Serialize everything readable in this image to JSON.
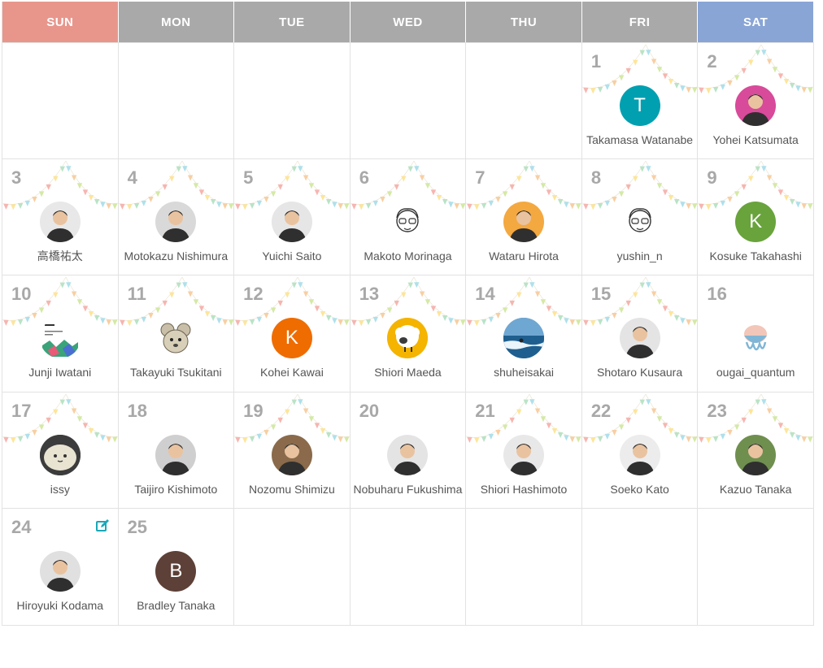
{
  "weekdays": [
    "SUN",
    "MON",
    "TUE",
    "WED",
    "THU",
    "FRI",
    "SAT"
  ],
  "colors": {
    "sunday_header": "#e8968c",
    "saturday_header": "#89a5d6",
    "weekday_header": "#a9a9a9",
    "day_number": "#a8a8a8",
    "edit_icon": "#1aa8b8"
  },
  "days": [
    {
      "day": "1",
      "name": "Takamasa Watanabe",
      "avatar": {
        "type": "letter",
        "letter": "T",
        "bg": "#00a0b0"
      },
      "bunting": true
    },
    {
      "day": "2",
      "name": "Yohei Katsumata",
      "avatar": {
        "type": "photo",
        "icon": "person-photo-icon",
        "bg": "#d84a9a"
      },
      "bunting": true
    },
    {
      "day": "3",
      "name": "高橋祐太",
      "avatar": {
        "type": "photo",
        "icon": "person-photo-icon",
        "bg": "#e8e8e8"
      },
      "bunting": true
    },
    {
      "day": "4",
      "name": "Motokazu Nishimura",
      "avatar": {
        "type": "photo",
        "icon": "person-photo-icon",
        "bg": "#d9d9d9"
      },
      "bunting": true
    },
    {
      "day": "5",
      "name": "Yuichi Saito",
      "avatar": {
        "type": "photo",
        "icon": "person-photo-icon",
        "bg": "#e6e6e6"
      },
      "bunting": true
    },
    {
      "day": "6",
      "name": "Makoto Morinaga",
      "avatar": {
        "type": "sketch",
        "icon": "sketch-face-icon",
        "bg": "#ffffff"
      },
      "bunting": true
    },
    {
      "day": "7",
      "name": "Wataru Hirota",
      "avatar": {
        "type": "photo",
        "icon": "person-photo-icon",
        "bg": "#f4a840"
      },
      "bunting": true
    },
    {
      "day": "8",
      "name": "yushin_n",
      "avatar": {
        "type": "sketch",
        "icon": "sketch-face-icon",
        "bg": "#ffffff"
      },
      "bunting": true
    },
    {
      "day": "9",
      "name": "Kosuke Takahashi",
      "avatar": {
        "type": "letter",
        "letter": "K",
        "bg": "#69a33c"
      },
      "bunting": true
    },
    {
      "day": "10",
      "name": "Junji Iwatani",
      "avatar": {
        "type": "book",
        "icon": "book-cover-icon",
        "bg": "#ffffff"
      },
      "bunting": true
    },
    {
      "day": "11",
      "name": "Takayuki Tsukitani",
      "avatar": {
        "type": "mouse",
        "icon": "mouse-character-icon",
        "bg": "#ffffff"
      },
      "bunting": true
    },
    {
      "day": "12",
      "name": "Kohei Kawai",
      "avatar": {
        "type": "letter",
        "letter": "K",
        "bg": "#ef6c00"
      },
      "bunting": true
    },
    {
      "day": "13",
      "name": "Shiori Maeda",
      "avatar": {
        "type": "sheep",
        "icon": "sheep-icon",
        "bg": "#f4b400"
      },
      "bunting": true
    },
    {
      "day": "14",
      "name": "shuheisakai",
      "avatar": {
        "type": "sea",
        "icon": "surf-photo-icon",
        "bg": "#2c6fa0"
      },
      "bunting": true
    },
    {
      "day": "15",
      "name": "Shotaro Kusaura",
      "avatar": {
        "type": "photo",
        "icon": "person-photo-icon",
        "bg": "#e4e4e4"
      },
      "bunting": true
    },
    {
      "day": "16",
      "name": "ougai_quantum",
      "avatar": {
        "type": "jelly",
        "icon": "jellyfish-icon",
        "bg": "#ffffff"
      },
      "bunting": false
    },
    {
      "day": "17",
      "name": "issy",
      "avatar": {
        "type": "blob",
        "icon": "blob-character-icon",
        "bg": "#3c3c3c"
      },
      "bunting": true
    },
    {
      "day": "18",
      "name": "Taijiro Kishimoto",
      "avatar": {
        "type": "photo",
        "icon": "person-photo-icon",
        "bg": "#cfcfcf"
      },
      "bunting": false
    },
    {
      "day": "19",
      "name": "Nozomu Shimizu",
      "avatar": {
        "type": "photo",
        "icon": "person-photo-icon",
        "bg": "#8a6a4a"
      },
      "bunting": true
    },
    {
      "day": "20",
      "name": "Nobuharu Fukushima",
      "avatar": {
        "type": "photo",
        "icon": "person-photo-icon",
        "bg": "#e4e4e4"
      },
      "bunting": false
    },
    {
      "day": "21",
      "name": "Shiori Hashimoto",
      "avatar": {
        "type": "photo",
        "icon": "person-photo-icon",
        "bg": "#e8e8e8"
      },
      "bunting": true
    },
    {
      "day": "22",
      "name": "Soeko Kato",
      "avatar": {
        "type": "photo",
        "icon": "person-photo-icon",
        "bg": "#ececec"
      },
      "bunting": true
    },
    {
      "day": "23",
      "name": "Kazuo Tanaka",
      "avatar": {
        "type": "photo",
        "icon": "person-photo-icon",
        "bg": "#6f8f4f"
      },
      "bunting": true
    },
    {
      "day": "24",
      "name": "Hiroyuki Kodama",
      "avatar": {
        "type": "photo",
        "icon": "person-photo-icon",
        "bg": "#e0e0e0"
      },
      "bunting": false,
      "edit": true
    },
    {
      "day": "25",
      "name": "Bradley Tanaka",
      "avatar": {
        "type": "letter",
        "letter": "B",
        "bg": "#5d4037"
      },
      "bunting": false
    }
  ]
}
